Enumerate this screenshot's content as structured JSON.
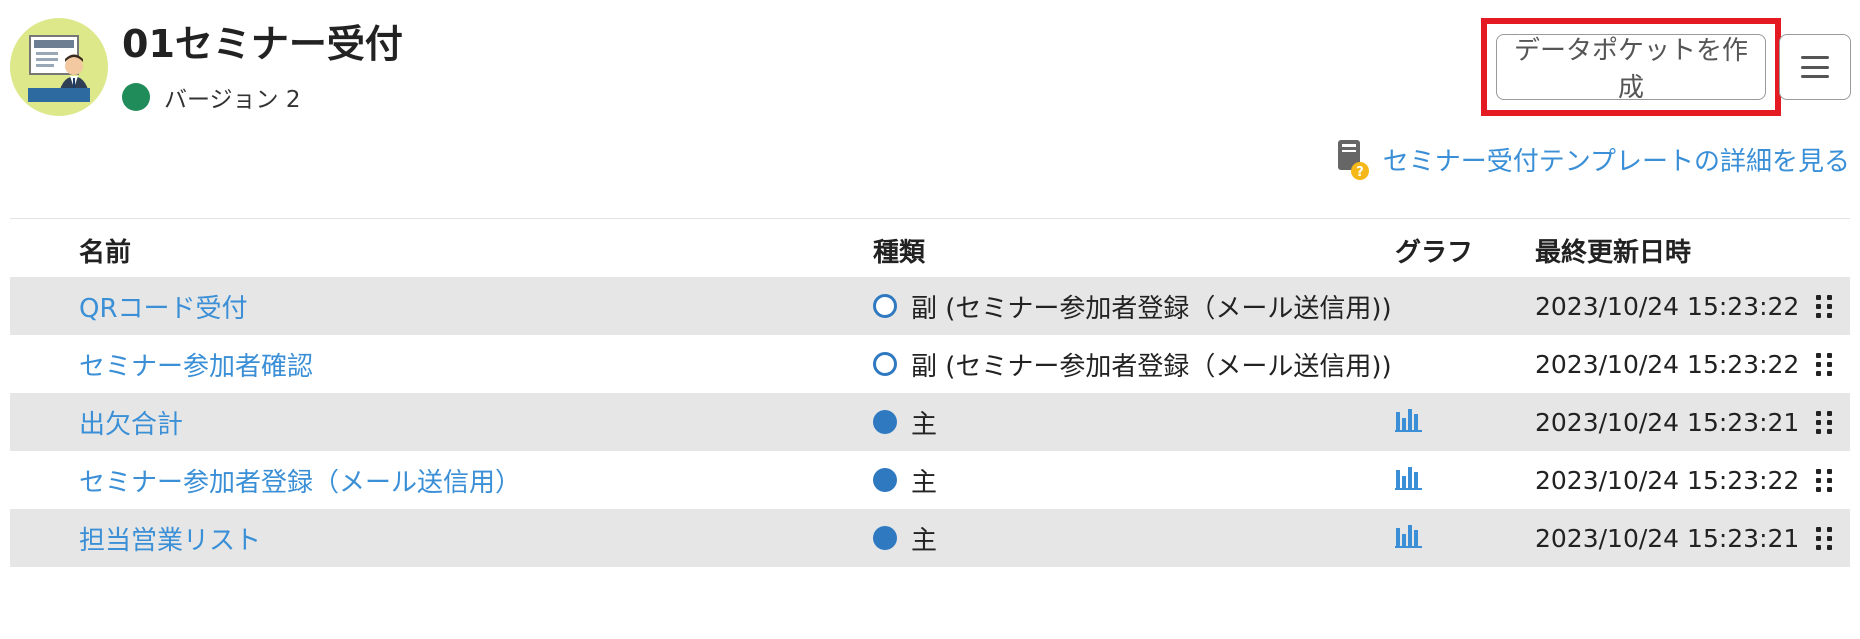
{
  "header": {
    "title": "01セミナー受付",
    "version": "バージョン 2",
    "status_color": "#1f8c5a",
    "create_button_label": "データポケットを作成",
    "menu_icon": "hamburger-menu-icon",
    "template_link_label": "セミナー受付テンプレートの詳細を見る"
  },
  "table": {
    "headers": {
      "name": "名前",
      "type": "種類",
      "graph": "グラフ",
      "updated": "最終更新日時"
    },
    "rows": [
      {
        "name": "QRコード受付",
        "type": "副 (セミナー参加者登録（メール送信用))",
        "type_kind": "sub",
        "has_graph": false,
        "updated": "2023/10/24 15:23:22"
      },
      {
        "name": "セミナー参加者確認",
        "type": "副 (セミナー参加者登録（メール送信用))",
        "type_kind": "sub",
        "has_graph": false,
        "updated": "2023/10/24 15:23:22"
      },
      {
        "name": "出欠合計",
        "type": "主",
        "type_kind": "main",
        "has_graph": true,
        "updated": "2023/10/24 15:23:21"
      },
      {
        "name": "セミナー参加者登録（メール送信用）",
        "type": "主",
        "type_kind": "main",
        "has_graph": true,
        "updated": "2023/10/24 15:23:22"
      },
      {
        "name": "担当営業リスト",
        "type": "主",
        "type_kind": "main",
        "has_graph": true,
        "updated": "2023/10/24 15:23:21"
      }
    ]
  },
  "colors": {
    "link": "#3a8fd6",
    "type_icon": "#2f79c0",
    "highlight": "#e41b23",
    "row_alt": "#e6e6e6"
  }
}
